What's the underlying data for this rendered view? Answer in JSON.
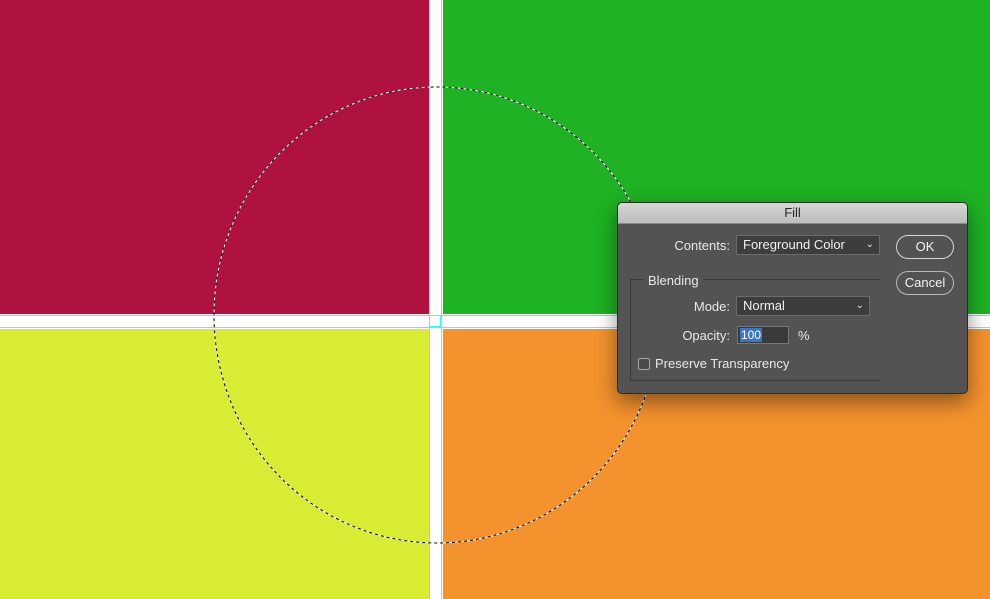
{
  "canvas": {
    "colors": {
      "top_left": "#b01240",
      "top_right": "#1fb224",
      "bottom_left": "#d9eb33",
      "bottom_right": "#f4922d",
      "gutter": "#ffffff",
      "guide": "#33ffff"
    }
  },
  "dialog": {
    "title": "Fill",
    "contents_label": "Contents:",
    "contents_value": "Foreground Color",
    "ok_label": "OK",
    "cancel_label": "Cancel",
    "blending_label": "Blending",
    "mode_label": "Mode:",
    "mode_value": "Normal",
    "opacity_label": "Opacity:",
    "opacity_value": "100",
    "opacity_unit": "%",
    "preserve_label": "Preserve Transparency",
    "preserve_checked": false,
    "dropdown_icon": "chevron-down-icon"
  }
}
